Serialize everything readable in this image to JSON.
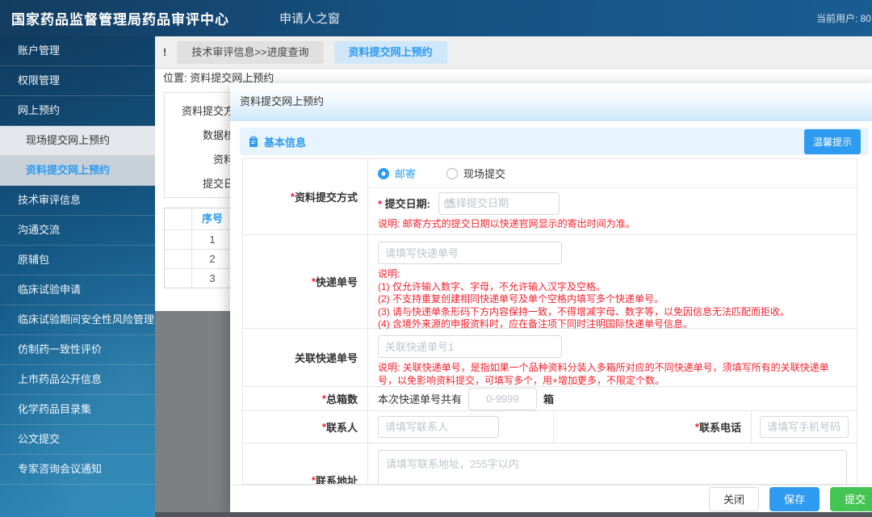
{
  "header": {
    "brand": "国家药品监督管理局药品审评中心",
    "portal": "申请人之窗",
    "current_user": "当前用户: 80"
  },
  "sidebar": {
    "items": [
      {
        "label": "账户管理"
      },
      {
        "label": "权限管理"
      },
      {
        "label": "网上预约"
      },
      {
        "label": "现场提交网上预约"
      },
      {
        "label": "资料提交网上预约"
      },
      {
        "label": "技术审评信息"
      },
      {
        "label": "沟通交流"
      },
      {
        "label": "原辅包"
      },
      {
        "label": "临床试验申请"
      },
      {
        "label": "临床试验期间安全性风险管理"
      },
      {
        "label": "仿制药一致性评价"
      },
      {
        "label": "上市药品公开信息"
      },
      {
        "label": "化学药品目录集"
      },
      {
        "label": "公文提交"
      },
      {
        "label": "专家咨询会议通知"
      }
    ]
  },
  "tabs": {
    "alert": "!",
    "items": [
      {
        "label": "技术审评信息>>进度查询"
      },
      {
        "label": "资料提交网上预约"
      }
    ]
  },
  "breadcrumb": "位置: 资料提交网上预约",
  "background": {
    "query_labels": [
      "资料提交方",
      "数据核",
      "资料",
      "提交日"
    ],
    "table": {
      "col_seq": "序号",
      "rows": [
        "1",
        "2",
        "3"
      ]
    }
  },
  "modal": {
    "title": "资料提交网上预约",
    "section_title": "基本信息",
    "tip_button": "温馨提示",
    "form": {
      "submit_method": {
        "label": "资料提交方式",
        "radio_mail": "邮寄",
        "radio_onsite": "现场提交",
        "date_label": "提交日期:",
        "date_placeholder": "选择提交日期",
        "hint": "说明: 邮寄方式的提交日期以快递官网显示的寄出时间为准。"
      },
      "tracking": {
        "label": "快递单号",
        "placeholder": "请填写快递单号",
        "hints": [
          "说明:",
          "(1) 仅允许输入数字、字母，不允许输入汉字及空格。",
          "(2) 不支持重复创建相同快递单号及单个空格内填写多个快递单号。",
          "(3) 请与快递单条形码下方内容保持一致，不得增减字母、数字等，以免因信息无法匹配而拒收。",
          "(4) 含境外来源的申报资料时，应在备注项下同时注明国际快递单号信息。"
        ]
      },
      "related": {
        "label": "关联快递单号",
        "placeholder": "关联快递单号1",
        "hint": "说明: 关联快递单号，是指如果一个品种资料分装入多箱所对应的不同快递单号，须填写所有的关联快递单号，以免影响资料提交，可填写多个，用+增加更多，不限定个数。"
      },
      "boxes": {
        "label": "总箱数",
        "prefix": "本次快递单号共有",
        "placeholder": "0-9999",
        "suffix": "箱"
      },
      "contact": {
        "label": "联系人",
        "placeholder": "请填写联系人"
      },
      "phone": {
        "label": "联系电话",
        "placeholder": "请填写手机号码"
      },
      "address": {
        "label": "联系地址",
        "placeholder": "请填写联系地址，255字以内"
      }
    },
    "footer": {
      "close": "关闭",
      "save": "保存",
      "submit": "提交"
    }
  },
  "colors": {
    "accent": "#2e9bf0",
    "success": "#44c553",
    "danger": "#f5222d",
    "header_bg": "#16507f",
    "sidebar_bg": "#176190",
    "overlay": "#7d8083"
  }
}
